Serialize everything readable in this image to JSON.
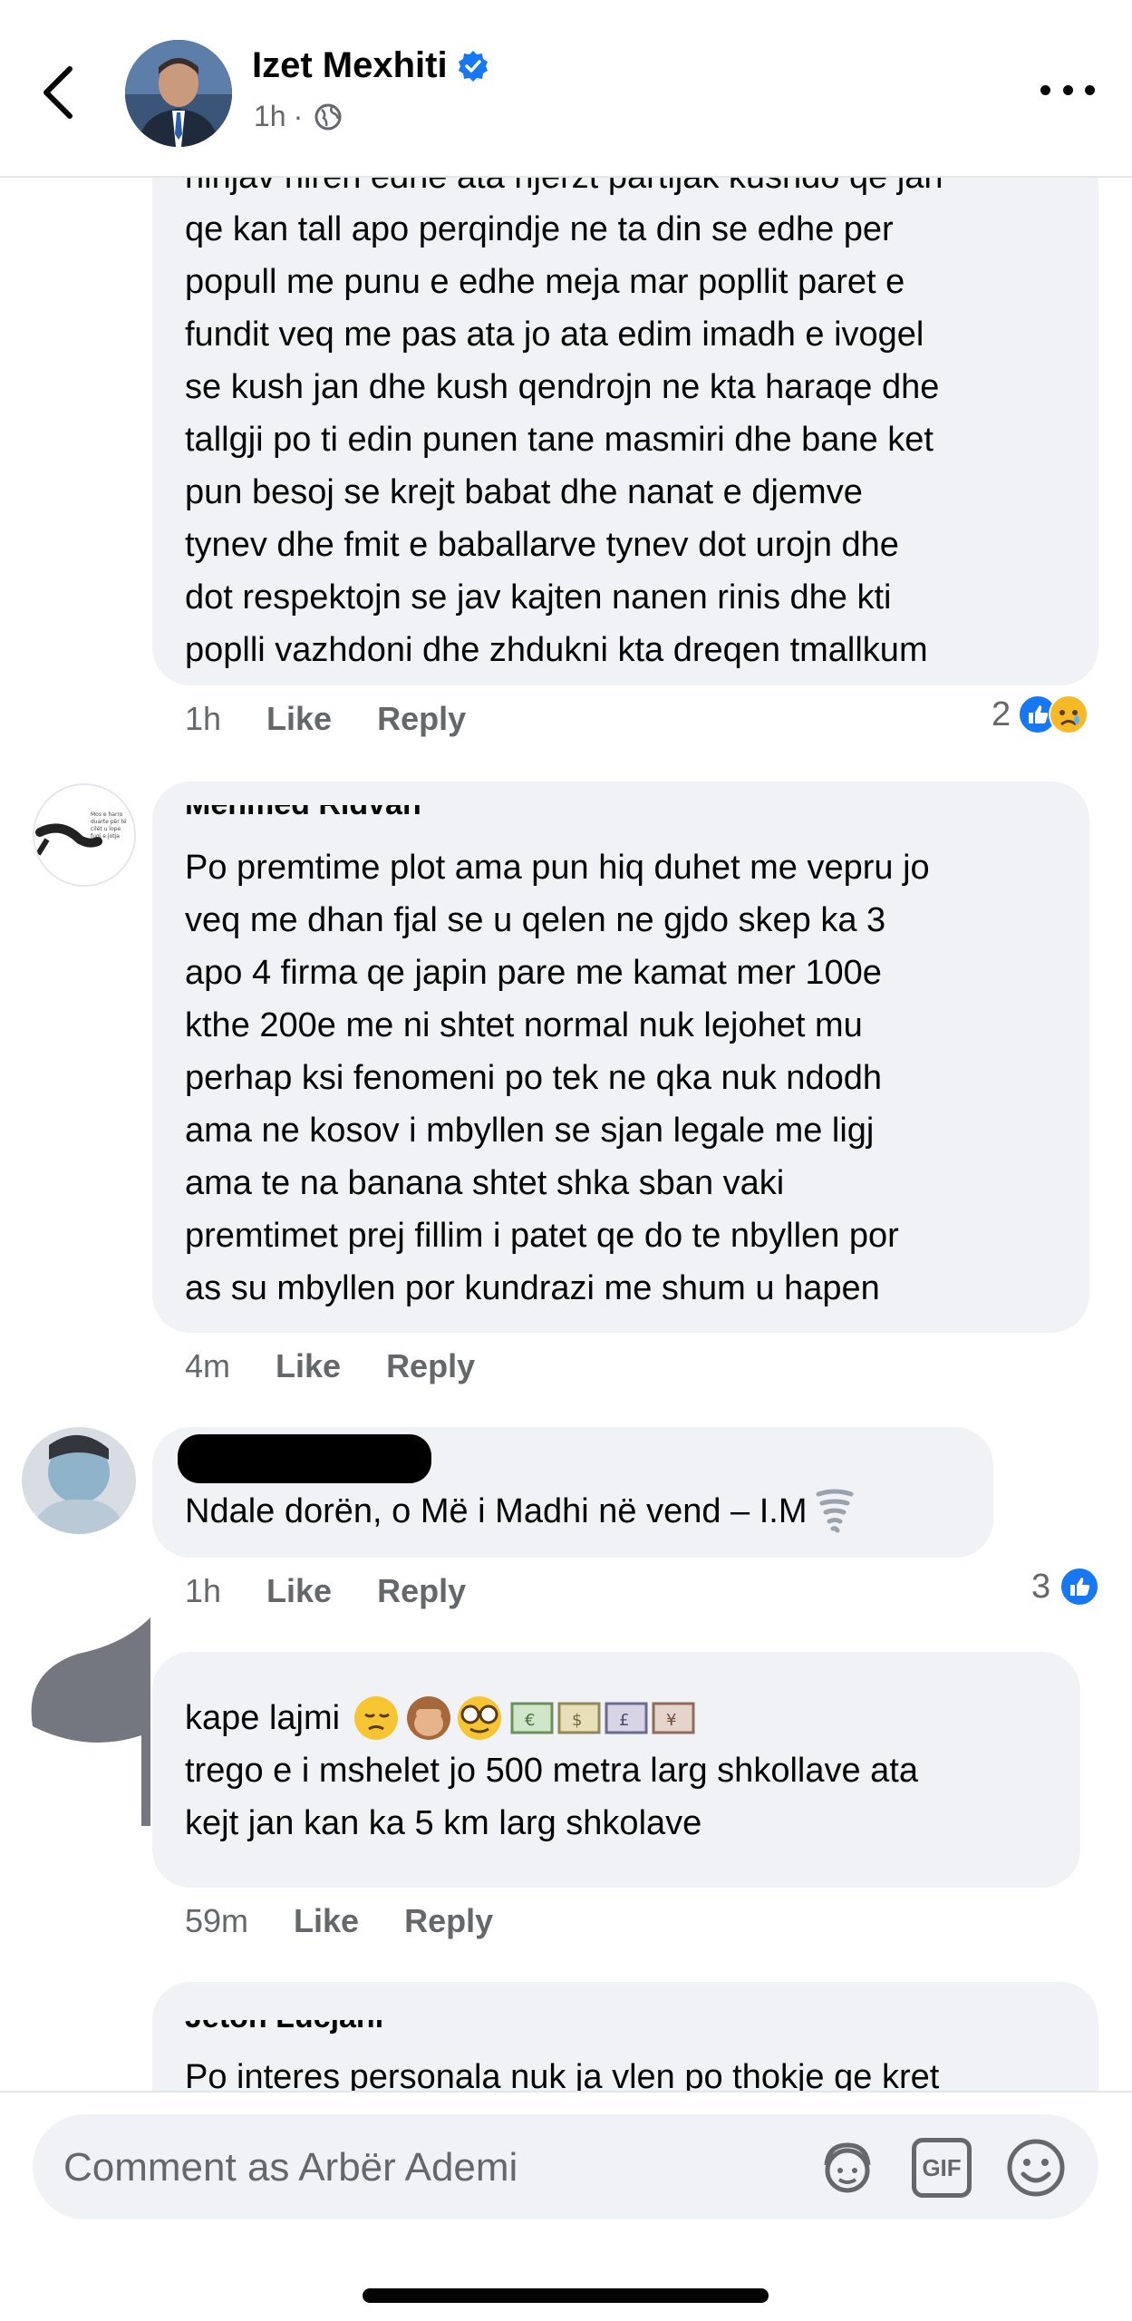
{
  "header": {
    "name": "Izet Mexhiti",
    "time": "1h",
    "dot": "·"
  },
  "comments": [
    {
      "text": "hinjav hiren edhe ata njerzt partijak kushdo qe jan\nqe kan tall apo perqindje ne ta din se edhe per\npopull me punu e edhe meja mar popllit paret e\nfundit veq me pas ata jo ata edim imadh e ivogel\nse kush jan dhe kush qendrojn ne kta haraqe dhe\ntallgji po ti edin punen tane masmiri dhe bane ket\npun besoj se krejt babat dhe nanat e djemve\ntynev dhe fmit e baballarve tynev dot urojn dhe\ndot respektojn se jav kajten nanen rinis dhe kti\npoplli vazhdoni dhe zhdukni kta dreqen tmallkum",
      "time": "1h",
      "like": "Like",
      "reply": "Reply",
      "reactions": "2"
    },
    {
      "author": "Mehmed Ridvan",
      "text": "Po premtime plot ama pun hiq duhet me vepru jo\nveq me dhan fjal se u qelen ne gjdo skep ka 3\napo 4 firma qe japin pare me kamat mer 100e\nkthe 200e me ni shtet normal nuk lejohet mu\nperhap ksi fenomeni po tek ne qka nuk ndodh\nama ne kosov i mbyllen se sjan legale me ligj\nama te na banana shtet shka sban vaki\npremtimet prej fillim i patet qe do te nbyllen por\nas su mbyllen por kundrazi me shum u hapen",
      "time": "4m",
      "like": "Like",
      "reply": "Reply",
      "avatar_text": "Mos e harro duarte për të cilët u lope fuqi e jotja nuk të mbante."
    },
    {
      "text": "Ndale dorën, o Më i Madhi në vend – I.M",
      "time": "1h",
      "like": "Like",
      "reply": "Reply",
      "reactions": "3"
    },
    {
      "text_line1": "kape lajmi",
      "text": "trego e i mshelet jo 500 metra larg shkollave ata\nkejt jan kan ka 5 km larg shkolave",
      "time": "59m",
      "like": "Like",
      "reply": "Reply"
    },
    {
      "author": "Jeton Lucjani",
      "text": "Po interes personala nuk ja vlen po thokje qe kret"
    }
  ],
  "composer": {
    "placeholder": "Comment as Arbër Ademi",
    "gif_label": "GIF"
  },
  "colors": {
    "bubble": "#f0f2f5",
    "meta": "#65676b",
    "like_blue": "#1877f2",
    "verified": "#1877f2"
  }
}
